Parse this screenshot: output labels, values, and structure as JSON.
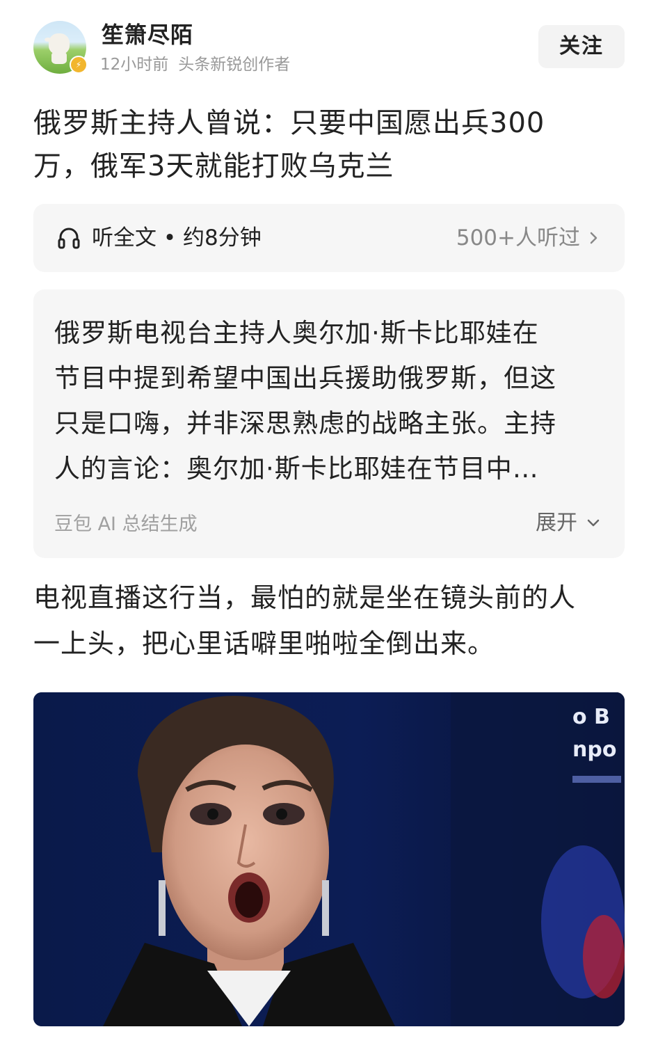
{
  "author": {
    "name": "笙箫尽陌",
    "time": "12小时前",
    "title": "头条新锐创作者",
    "follow_label": "关注"
  },
  "article": {
    "title_lines": [
      "俄罗斯主持人曾说：只要中国愿出兵300",
      "万，俄军3天就能打败乌克兰"
    ]
  },
  "listen": {
    "label": "听全文 • 约8分钟",
    "count": "500+人听过"
  },
  "summary": {
    "lines": [
      "俄罗斯电视台主持人奥尔加·斯卡比耶娃在",
      "节目中提到希望中国出兵援助俄罗斯，但这",
      "只是口嗨，并非深思熟虑的战略主张。主持",
      "人的言论：奥尔加·斯卡比耶娃在节目中…"
    ],
    "source": "豆包 AI 总结生成",
    "expand_label": "展开"
  },
  "body": {
    "lines": [
      "电视直播这行当，最怕的就是坐在镜头前的人",
      "一上头，把心里话噼里啪啦全倒出来。"
    ]
  },
  "image": {
    "overlay_lines": [
      "o B",
      "npo"
    ]
  },
  "colors": {
    "text": "#222222",
    "muted": "#999999",
    "panel": "#f6f6f6",
    "badge": "#f2b62e"
  }
}
